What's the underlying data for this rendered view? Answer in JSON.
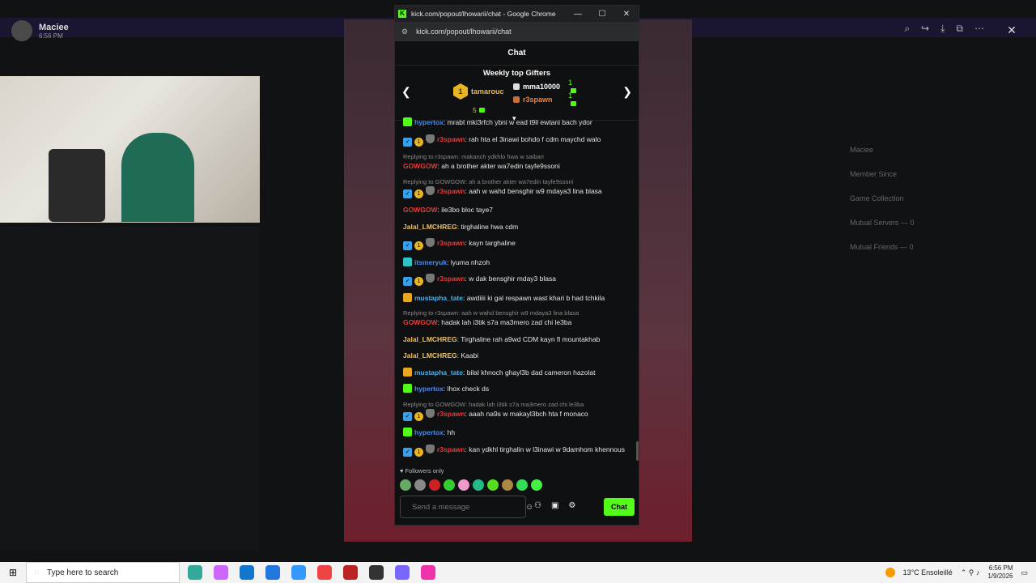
{
  "background": {
    "profile_name": "Maciee",
    "profile_time": "6:56 PM",
    "right_panel": [
      "Maciee",
      "Member Since",
      "Game Collection",
      "Mutual Servers — 0",
      "Mutual Friends — 0"
    ]
  },
  "window": {
    "title": "kick.com/popout/lhowarii/chat - Google Chrome",
    "url": "kick.com/popout/lhowarii/chat"
  },
  "chat": {
    "header": "Chat",
    "gifters_title": "Weekly top Gifters",
    "top_gifter": {
      "rank": "1",
      "name": "tamarouc",
      "count": "5"
    },
    "gifters": [
      {
        "name": "mma10000",
        "count": "1",
        "color": "#ffffff"
      },
      {
        "name": "r3spawn",
        "count": "1",
        "color": "#f0843a"
      }
    ],
    "messages": [
      {
        "reply": "",
        "badges": [
          "green"
        ],
        "user": "hypertox",
        "color": "#4a8df0",
        "text": ": mrabt mki3rfch ybni w ead t9il ewtani bach ydor"
      },
      {
        "reply": "",
        "badges": [
          "blue",
          "gold",
          "hat"
        ],
        "user": "r3spawn",
        "color": "#e83a3a",
        "text": ": rah hta el 3inawi bohdo f cdm maychd walo"
      },
      {
        "reply": "Replying to r3spawn: makanch ydkhlo hwa w saibari",
        "badges": [],
        "user": "GOWGOW",
        "color": "#e83a3a",
        "text": ": ah a brother akter wa7edin tayfe9ssoni"
      },
      {
        "reply": "Replying to GOWGOW: ah a brother akter wa7edin tayfe9ssoni",
        "badges": [
          "blue",
          "gold",
          "hat"
        ],
        "user": "r3spawn",
        "color": "#e83a3a",
        "text": ": aah w wahd bensghir w9 mdaya3 lina blasa"
      },
      {
        "reply": "",
        "badges": [],
        "user": "GOWGOW",
        "color": "#e83a3a",
        "text": ": ile3bo bloc taye7"
      },
      {
        "reply": "",
        "badges": [],
        "user": "Jalal_LMCHREG",
        "color": "#f0c060",
        "text": ": tirghaline hwa cdm"
      },
      {
        "reply": "",
        "badges": [
          "blue",
          "gold",
          "hat"
        ],
        "user": "r3spawn",
        "color": "#e83a3a",
        "text": ": kayn targhaline"
      },
      {
        "reply": "",
        "badges": [
          "teal"
        ],
        "user": "itsmeryuk",
        "color": "#4a8df0",
        "text": ": lyuma nhzoh"
      },
      {
        "reply": "",
        "badges": [
          "blue",
          "gold",
          "hat"
        ],
        "user": "r3spawn",
        "color": "#e83a3a",
        "text": ": w dak bensghir mday3 blasa"
      },
      {
        "reply": "",
        "badges": [
          "crown"
        ],
        "user": "mustapha_tate",
        "color": "#4ab0f0",
        "text": ": awdiiii ki gal respawn wast khari b had tchkila"
      },
      {
        "reply": "Replying to r3spawn: aah w wahd bensghir w9 mdaya3 lina blasa",
        "badges": [],
        "user": "GOWGOW",
        "color": "#e83a3a",
        "text": ": hadak lah i3tik s7a ma3mero zad chi le3ba"
      },
      {
        "reply": "",
        "badges": [],
        "user": "Jalal_LMCHREG",
        "color": "#f0c060",
        "text": ": Tirghaline rah a9wd CDM kayn fl mountakhab"
      },
      {
        "reply": "",
        "badges": [],
        "user": "Jalal_LMCHREG",
        "color": "#f0c060",
        "text": ": Kaabi"
      },
      {
        "reply": "",
        "badges": [
          "crown"
        ],
        "user": "mustapha_tate",
        "color": "#4ab0f0",
        "text": ": bilal khnoch ghayl3b dad cameron hazolat"
      },
      {
        "reply": "",
        "badges": [
          "green"
        ],
        "user": "hypertox",
        "color": "#4a8df0",
        "text": ": lhox check ds"
      },
      {
        "reply": "Replying to GOWGOW: hadak lah i3tik s7a ma3mero zad chi le3ba",
        "badges": [
          "blue",
          "gold",
          "hat"
        ],
        "user": "r3spawn",
        "color": "#e83a3a",
        "text": ": aaah na9s w makayl3bch hta f monaco"
      },
      {
        "reply": "",
        "badges": [
          "green"
        ],
        "user": "hypertox",
        "color": "#4a8df0",
        "text": ": hh"
      },
      {
        "reply": "",
        "badges": [
          "blue",
          "gold",
          "hat"
        ],
        "user": "r3spawn",
        "color": "#e83a3a",
        "text": ": kan ydkhl tirghalin w l3inawi w 9damhom khennous",
        "wrap": true
      }
    ],
    "followers_label": "Followers only",
    "input_placeholder": "Send a message",
    "send_label": "Chat"
  },
  "taskbar": {
    "search_placeholder": "Type here to search",
    "weather": "13°C Ensoleillé",
    "time": "6:56 PM",
    "date": "1/9/2026"
  }
}
